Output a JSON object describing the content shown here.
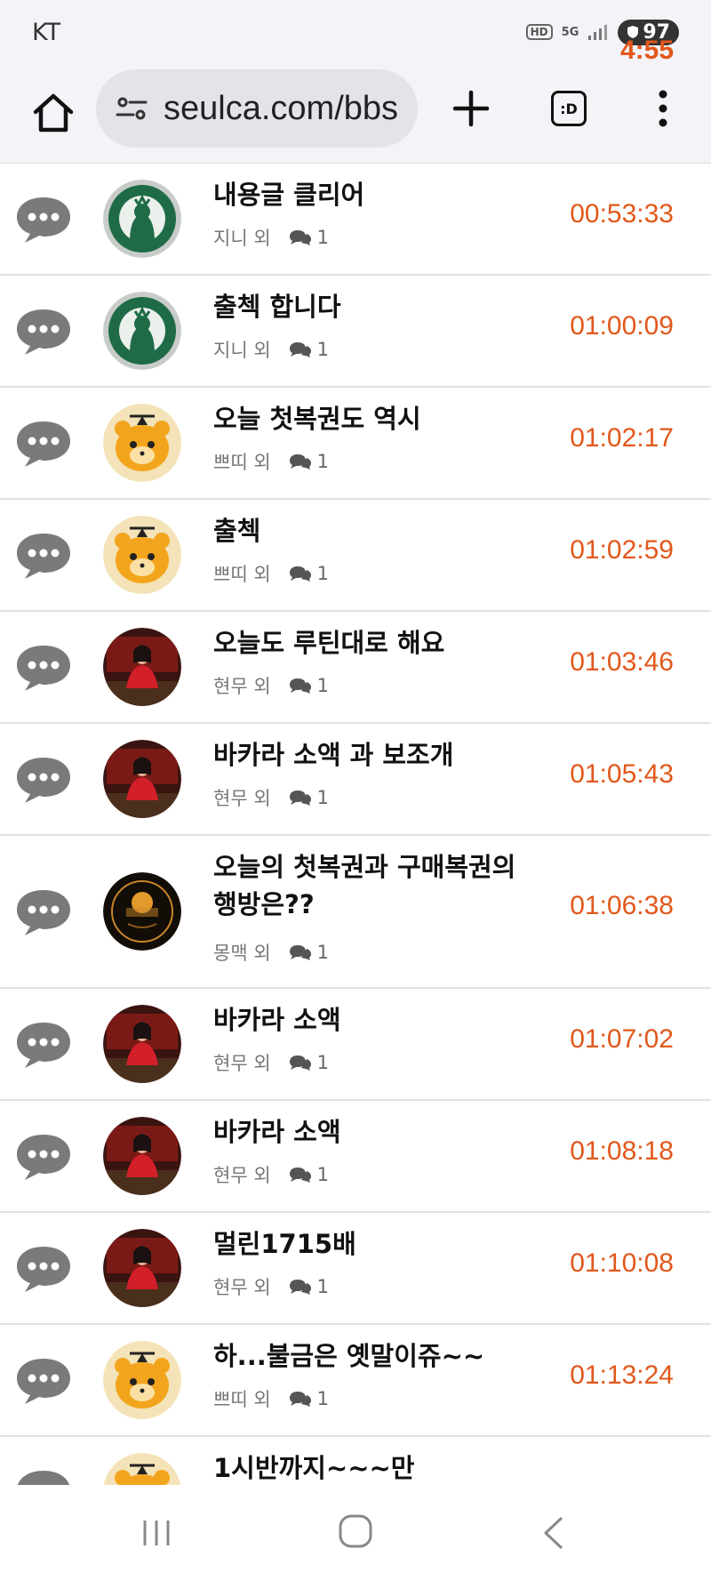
{
  "status_bar": {
    "carrier": "KT",
    "time": "4:55",
    "hd_label": "HD",
    "network_label": "5G",
    "battery": "97"
  },
  "browser": {
    "url": "seulca.com/bbs",
    "tabs_label": ":D"
  },
  "colors": {
    "time": "#e2581b",
    "chat_icon": "#7a7a7a"
  },
  "posts": [
    {
      "title": "내용글 클리어",
      "author": "지니 외",
      "comments": "1",
      "time": "00:53:33",
      "avatar": "starbucks-avatar"
    },
    {
      "title": "출첵 합니다",
      "author": "지니 외",
      "comments": "1",
      "time": "01:00:09",
      "avatar": "starbucks-avatar"
    },
    {
      "title": "오늘 첫복권도 역시",
      "author": "쁘띠 외",
      "comments": "1",
      "time": "01:02:17",
      "avatar": "tiger-avatar"
    },
    {
      "title": "출첵",
      "author": "쁘띠 외",
      "comments": "1",
      "time": "01:02:59",
      "avatar": "tiger-avatar"
    },
    {
      "title": "오늘도 루틴대로 해요",
      "author": "현무 외",
      "comments": "1",
      "time": "01:03:46",
      "avatar": "dealer-avatar"
    },
    {
      "title": "바카라 소액 과 보조개",
      "author": "현무 외",
      "comments": "1",
      "time": "01:05:43",
      "avatar": "dealer-avatar"
    },
    {
      "title": "오늘의 첫복권과 구매복권의 행방은??",
      "author": "몽맥 외",
      "comments": "1",
      "time": "01:06:38",
      "avatar": "play-logo-avatar"
    },
    {
      "title": "바카라 소액",
      "author": "현무 외",
      "comments": "1",
      "time": "01:07:02",
      "avatar": "dealer-avatar"
    },
    {
      "title": "바카라 소액",
      "author": "현무 외",
      "comments": "1",
      "time": "01:08:18",
      "avatar": "dealer-avatar"
    },
    {
      "title": "멀린1715배",
      "author": "현무 외",
      "comments": "1",
      "time": "01:10:08",
      "avatar": "dealer-avatar"
    },
    {
      "title": "하...불금은 옛말이쥬~~",
      "author": "쁘띠 외",
      "comments": "1",
      "time": "01:13:24",
      "avatar": "tiger-avatar"
    },
    {
      "title": "1시반까지~~~만",
      "author": "",
      "comments": "",
      "time": "",
      "avatar": "tiger-avatar"
    }
  ]
}
